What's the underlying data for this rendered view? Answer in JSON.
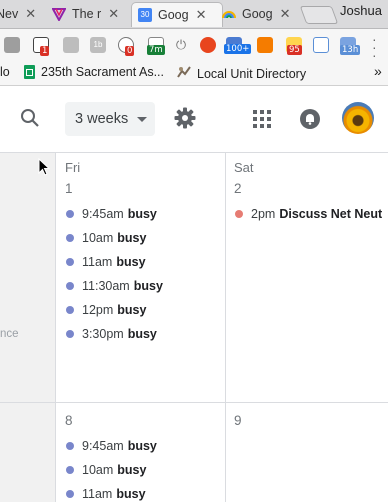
{
  "browser": {
    "tabs": [
      {
        "label": "Nev",
        "active": false
      },
      {
        "label": "The r",
        "active": false
      },
      {
        "label": "Goog",
        "active": true,
        "favicon_text": "30"
      },
      {
        "label": "Goog",
        "active": false
      }
    ],
    "profile_name": "Joshua",
    "extensions": [
      {
        "name": "puzzle-ext-icon"
      },
      {
        "name": "sync-ext-icon",
        "badge": "1",
        "badge_color": "#d93025"
      },
      {
        "name": "media-ext-icon"
      },
      {
        "name": "counter-ext-icon",
        "text": "1b"
      },
      {
        "name": "reddit-ext-icon",
        "badge": "0",
        "badge_color": "#d93025"
      },
      {
        "name": "timer-ext-icon",
        "badge": "7m",
        "badge_color": "#188038"
      },
      {
        "name": "power-ext-icon"
      },
      {
        "name": "shield-ext-icon",
        "color": "#e8451e"
      },
      {
        "name": "stats-ext-icon",
        "badge": "100+",
        "badge_color": "#1a73e8"
      },
      {
        "name": "app-ext-icon",
        "color": "#f57c00"
      },
      {
        "name": "percent-ext-icon",
        "badge": "95",
        "badge_color": "#d93025"
      },
      {
        "name": "calendar-ext-icon"
      },
      {
        "name": "hours-ext-icon",
        "badge": "13h",
        "badge_color": "#5b8fd6"
      }
    ],
    "bookmarks": [
      {
        "label": "lo"
      },
      {
        "label": "235th Sacrament As..."
      },
      {
        "label": "Local Unit Directory"
      }
    ],
    "more_bookmarks": "»"
  },
  "calendar": {
    "view_label": "3 weeks",
    "side_label": "nce",
    "days": [
      {
        "dow": "Fri",
        "num": "1",
        "events": [
          {
            "time": "9:45am",
            "title": "busy",
            "color": "#7986cb"
          },
          {
            "time": "10am",
            "title": "busy",
            "color": "#7986cb"
          },
          {
            "time": "11am",
            "title": "busy",
            "color": "#7986cb"
          },
          {
            "time": "11:30am",
            "title": "busy",
            "color": "#7986cb"
          },
          {
            "time": "12pm",
            "title": "busy",
            "color": "#7986cb"
          },
          {
            "time": "3:30pm",
            "title": "busy",
            "color": "#7986cb"
          }
        ]
      },
      {
        "dow": "Sat",
        "num": "2",
        "events": [
          {
            "time": "2pm",
            "title": "Discuss Net Neut",
            "color": "#e67c73"
          }
        ]
      },
      {
        "num": "8",
        "events": [
          {
            "time": "9:45am",
            "title": "busy",
            "color": "#7986cb"
          },
          {
            "time": "10am",
            "title": "busy",
            "color": "#7986cb"
          },
          {
            "time": "11am",
            "title": "busy",
            "color": "#7986cb"
          }
        ]
      },
      {
        "num": "9",
        "events": []
      }
    ]
  }
}
